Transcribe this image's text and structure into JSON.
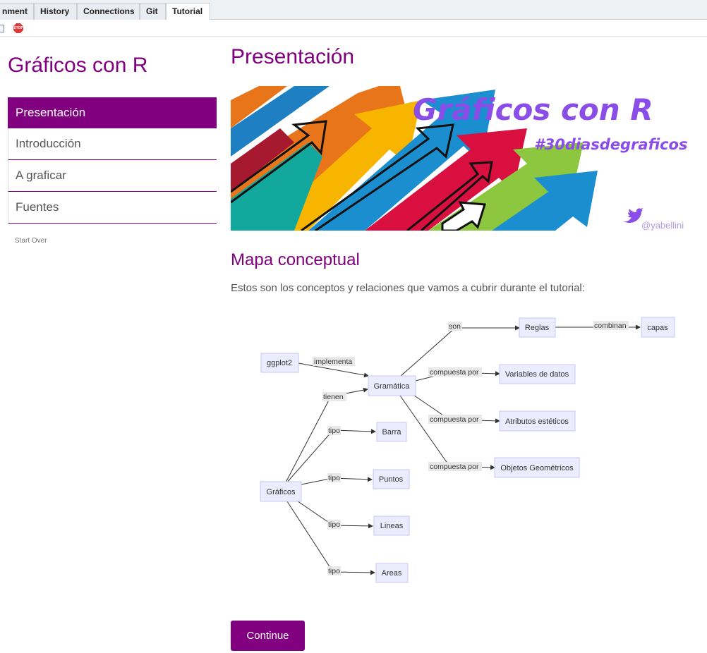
{
  "tabs": [
    {
      "label": "nment",
      "active": false
    },
    {
      "label": "History",
      "active": false
    },
    {
      "label": "Connections",
      "active": false
    },
    {
      "label": "Git",
      "active": false
    },
    {
      "label": "Tutorial",
      "active": true
    }
  ],
  "toolbar": {
    "stop_icon_text": "STOP"
  },
  "sidebar": {
    "title": "Gráficos con R",
    "items": [
      {
        "label": "Presentación",
        "active": true
      },
      {
        "label": "Introducción",
        "active": false
      },
      {
        "label": "A graficar",
        "active": false
      },
      {
        "label": "Fuentes",
        "active": false
      }
    ],
    "start_over": "Start Over"
  },
  "main": {
    "title": "Presentación",
    "banner": {
      "title": "Gráficos con R",
      "hashtag": "#30diasdegraficos",
      "handle": "@yabellini"
    },
    "section_title": "Mapa conceptual",
    "intro": "Estos son los conceptos y relaciones que vamos a cubrir durante el tutorial:",
    "diagram": {
      "nodes": {
        "ggplot2": "ggplot2",
        "gramatica": "Gramática",
        "reglas": "Reglas",
        "capas": "capas",
        "variables": "Variables de datos",
        "atributos": "Atributos estéticos",
        "objetos": "Objetos Geométricos",
        "graficos": "Gráficos",
        "barra": "Barra",
        "puntos": "Puntos",
        "lineas": "Lineas",
        "areas": "Areas"
      },
      "edge_labels": {
        "implementa": "implementa",
        "son": "son",
        "combinan": "combinan",
        "compuesta_por": "compuesta por",
        "tienen": "tienen",
        "tipo": "tipo"
      }
    },
    "continue_label": "Continue"
  },
  "colors": {
    "accent": "#800080",
    "node_fill": "#ececff",
    "node_stroke": "#c8c8f0"
  }
}
